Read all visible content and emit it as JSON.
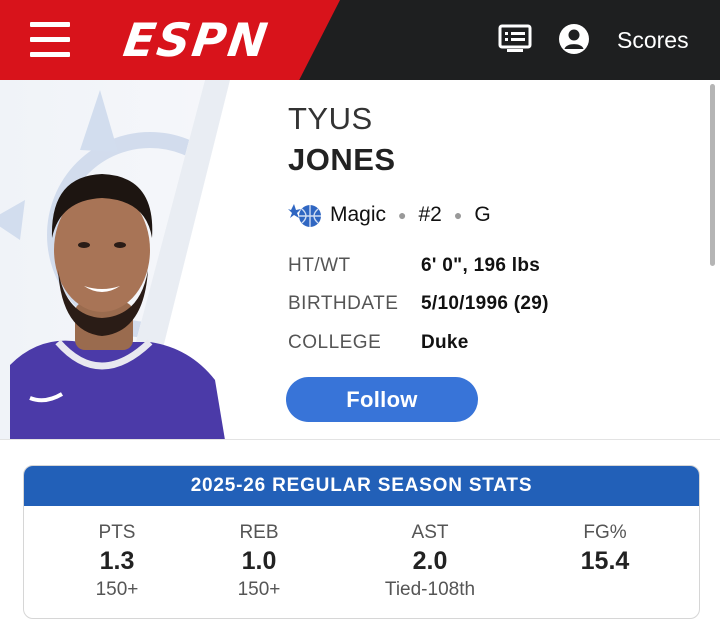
{
  "header": {
    "logo_text": "ESPN",
    "scores_label": "Scores",
    "menu_icon": "hamburger-menu-icon",
    "tv_icon": "tv-guide-icon",
    "account_icon": "account-icon",
    "colors": {
      "red": "#d8131b",
      "dark": "#1e1f20"
    }
  },
  "player": {
    "first_name": "TYUS",
    "last_name": "JONES",
    "team": "Magic",
    "number": "#2",
    "position": "G",
    "team_logo_icon": "orlando-magic-logo",
    "info": [
      {
        "label": "HT/WT",
        "value": "6' 0\", 196 lbs"
      },
      {
        "label": "BIRTHDATE",
        "value": "5/10/1996 (29)"
      },
      {
        "label": "COLLEGE",
        "value": "Duke"
      }
    ],
    "follow_label": "Follow",
    "follow_color": "#3874d8"
  },
  "stats": {
    "title": "2025-26 REGULAR SEASON STATS",
    "header_color": "#2260b8",
    "items": [
      {
        "label": "PTS",
        "value": "1.3",
        "rank": "150+"
      },
      {
        "label": "REB",
        "value": "1.0",
        "rank": "150+"
      },
      {
        "label": "AST",
        "value": "2.0",
        "rank": "Tied-108th"
      },
      {
        "label": "FG%",
        "value": "15.4",
        "rank": ""
      }
    ]
  }
}
